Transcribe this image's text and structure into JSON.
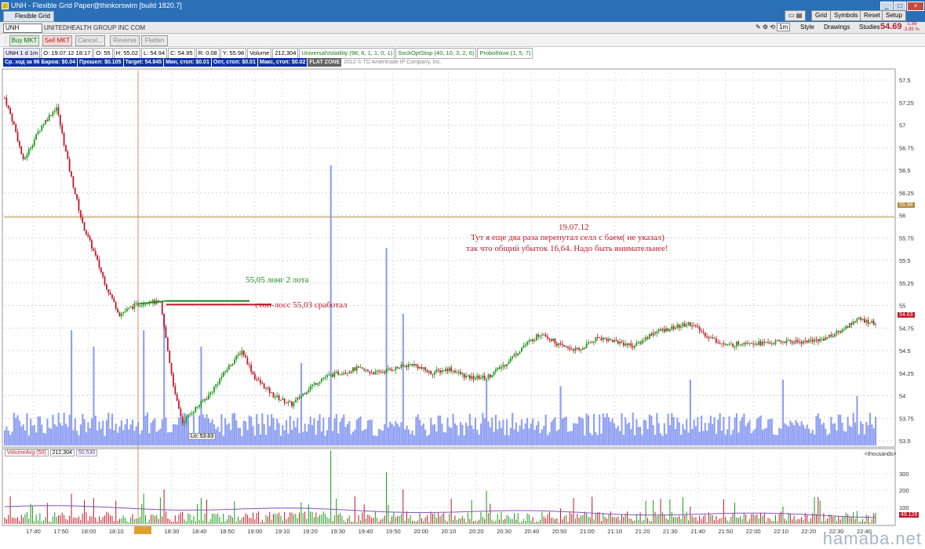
{
  "window": {
    "title": "UNH - Flexible Grid Paper@thinkorswim [build 1820.7]",
    "tab": "Flexible Grid"
  },
  "top_buttons": [
    "Grid",
    "Symbols",
    "Reset",
    "Setup"
  ],
  "toolbar": {
    "timeframe": "1m",
    "style": "Style",
    "drawings": "Drawings",
    "studies": "Studies",
    "last": "54.69",
    "change": "-1.86",
    "change_pct": "-3.95 %"
  },
  "symbol": {
    "ticker": "UNH",
    "description": "UNITEDHEALTH GROUP INC COM"
  },
  "order_buttons": [
    "Buy MKT",
    "Sell MKT",
    "Cancel...",
    "Reverse",
    "Flatten"
  ],
  "info": [
    "UNH 1 d 1m",
    "O: 19.07.12 18:17",
    "O: 55",
    "H: 55.02",
    "L: 54.94",
    "C: 54.95",
    "R: 0.08",
    "Y: 55.98",
    "Volume",
    "212,304",
    "UniversalVolatility (98, 6, 1, 1, 0, 1)",
    "SockOptStop (40, 10, 3, 2, 6)",
    "Probolhlow (1, 5, 7)"
  ],
  "stats": [
    "Ср. ход за 96 Баров: $0.04",
    "Прошел: $0.105",
    "Target: 54.845",
    "Мин, стоп: $0.01",
    "Опт, стоп: $0.01",
    "Макс, стоп: $0.02"
  ],
  "flat_zone": "FLAT ZONE",
  "copyright": "2012 © TD Ameritrade IP Company, Inc.",
  "annotations": {
    "date": "19.07.12",
    "line1": "Тут я еще два раза перепутал селл с баем( не указал)",
    "line2": "так что общий убыток 16,64. Надо быть внимательнее!",
    "long": "55,05 лонг 2 лота",
    "stop": "стоп-лосс 55,03 сработал",
    "low": "Lo: 53.63"
  },
  "price_markers": {
    "prev_close": "55.98",
    "current": "54.63"
  },
  "lower": {
    "study": "VolumeAvg (50)",
    "v1": "212,304",
    "v2": "50,530",
    "units": "<thousands>",
    "current": "49.126"
  },
  "watermark": "hamaba.net",
  "colors": {
    "up": "#1a9a1a",
    "down": "#c0182a",
    "volume": "#7b8ff0",
    "titlebar": "#2b6fb6"
  },
  "chart_data": {
    "type": "candlestick",
    "ylabels": [
      "57.5",
      "57.25",
      "57",
      "56.75",
      "56.5",
      "56.25",
      "56",
      "55.75",
      "55.5",
      "55.25",
      "55",
      "54.75",
      "54.5",
      "54.25",
      "54",
      "53.75",
      "53.5"
    ],
    "ylim": [
      53.5,
      57.5
    ],
    "xlabels": [
      "17:40",
      "17:50",
      "18:00",
      "18:10",
      "18:17",
      "18:30",
      "18:40",
      "18:50",
      "19:00",
      "19:10",
      "19:20",
      "19:30",
      "19:40",
      "19:50",
      "20:00",
      "20:10",
      "20:20",
      "20:30",
      "20:40",
      "20:50",
      "21:00",
      "21:10",
      "21:20",
      "21:30",
      "21:40",
      "21:50",
      "22:00",
      "22:10",
      "22:20",
      "22:30",
      "22:40"
    ],
    "lower_ylabels": [
      "300",
      "200",
      "100"
    ],
    "close_path": [
      [
        0,
        57.3
      ],
      [
        5,
        57.0
      ],
      [
        10,
        56.6
      ],
      [
        20,
        57.0
      ],
      [
        28,
        57.2
      ],
      [
        35,
        56.5
      ],
      [
        42,
        55.9
      ],
      [
        48,
        55.6
      ],
      [
        55,
        55.2
      ],
      [
        62,
        54.9
      ],
      [
        70,
        55.0
      ],
      [
        78,
        55.05
      ],
      [
        84,
        55.02
      ],
      [
        88,
        54.5
      ],
      [
        92,
        54.0
      ],
      [
        96,
        53.7
      ],
      [
        100,
        53.8
      ],
      [
        110,
        54.0
      ],
      [
        120,
        54.3
      ],
      [
        128,
        54.5
      ],
      [
        135,
        54.2
      ],
      [
        145,
        54.0
      ],
      [
        155,
        53.9
      ],
      [
        165,
        54.1
      ],
      [
        172,
        54.2
      ],
      [
        180,
        54.25
      ],
      [
        190,
        54.3
      ],
      [
        200,
        54.25
      ],
      [
        210,
        54.3
      ],
      [
        220,
        54.35
      ],
      [
        230,
        54.25
      ],
      [
        240,
        54.3
      ],
      [
        250,
        54.2
      ],
      [
        260,
        54.2
      ],
      [
        270,
        54.35
      ],
      [
        280,
        54.55
      ],
      [
        290,
        54.7
      ],
      [
        300,
        54.55
      ],
      [
        310,
        54.5
      ],
      [
        320,
        54.65
      ],
      [
        330,
        54.6
      ],
      [
        340,
        54.55
      ],
      [
        350,
        54.7
      ],
      [
        360,
        54.75
      ],
      [
        370,
        54.8
      ],
      [
        380,
        54.65
      ],
      [
        390,
        54.55
      ],
      [
        400,
        54.6
      ],
      [
        410,
        54.58
      ],
      [
        420,
        54.6
      ],
      [
        430,
        54.6
      ],
      [
        440,
        54.62
      ],
      [
        450,
        54.7
      ],
      [
        460,
        54.85
      ],
      [
        470,
        54.8
      ]
    ]
  }
}
